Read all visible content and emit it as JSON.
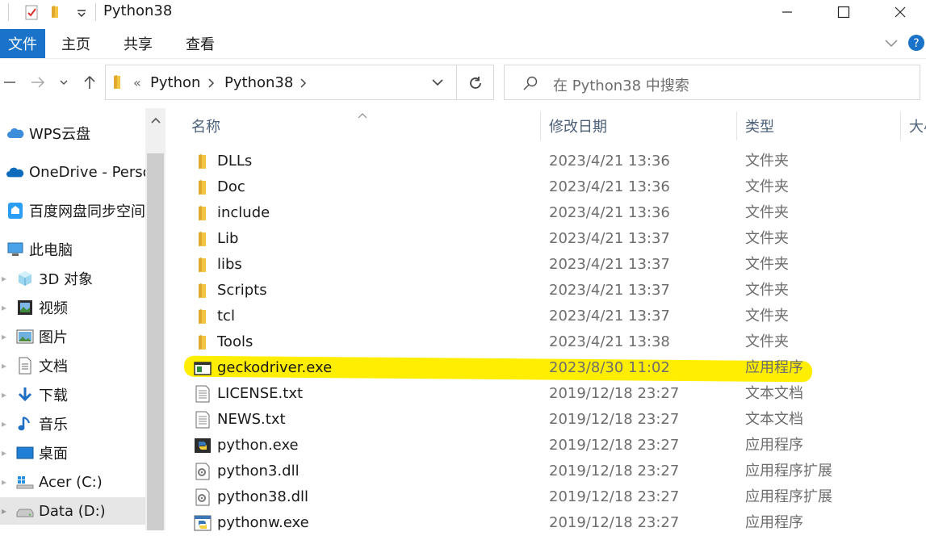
{
  "window": {
    "title": "Python38"
  },
  "ribbon": {
    "tabs": [
      "文件",
      "主页",
      "共享",
      "查看"
    ]
  },
  "address": {
    "prefix": "«",
    "crumbs": [
      "Python",
      "Python38"
    ]
  },
  "search": {
    "placeholder": "在 Python38 中搜索"
  },
  "sidebar": {
    "items": [
      {
        "label": "WPS云盘",
        "icon": "cloud-icon"
      },
      {
        "label": "OneDrive - Personal",
        "icon": "onedrive-icon"
      },
      {
        "label": "百度网盘同步空间",
        "icon": "baidu-netdisk-icon"
      },
      {
        "label": "此电脑",
        "icon": "computer-icon"
      },
      {
        "label": "3D 对象",
        "icon": "cube-icon"
      },
      {
        "label": "视频",
        "icon": "video-icon"
      },
      {
        "label": "图片",
        "icon": "picture-icon"
      },
      {
        "label": "文档",
        "icon": "document-icon"
      },
      {
        "label": "下载",
        "icon": "download-icon"
      },
      {
        "label": "音乐",
        "icon": "music-icon"
      },
      {
        "label": "桌面",
        "icon": "desktop-icon"
      },
      {
        "label": "Acer (C:)",
        "icon": "drive-icon"
      },
      {
        "label": "Data (D:)",
        "icon": "drive-icon"
      }
    ]
  },
  "columns": {
    "name": "名称",
    "date": "修改日期",
    "type": "类型",
    "size": "大小"
  },
  "files": [
    {
      "name": "DLLs",
      "date": "2023/4/21 13:36",
      "type": "文件夹",
      "icon": "folder-icon"
    },
    {
      "name": "Doc",
      "date": "2023/4/21 13:36",
      "type": "文件夹",
      "icon": "folder-icon"
    },
    {
      "name": "include",
      "date": "2023/4/21 13:36",
      "type": "文件夹",
      "icon": "folder-icon"
    },
    {
      "name": "Lib",
      "date": "2023/4/21 13:37",
      "type": "文件夹",
      "icon": "folder-icon"
    },
    {
      "name": "libs",
      "date": "2023/4/21 13:37",
      "type": "文件夹",
      "icon": "folder-icon"
    },
    {
      "name": "Scripts",
      "date": "2023/4/21 13:37",
      "type": "文件夹",
      "icon": "folder-icon"
    },
    {
      "name": "tcl",
      "date": "2023/4/21 13:37",
      "type": "文件夹",
      "icon": "folder-icon"
    },
    {
      "name": "Tools",
      "date": "2023/4/21 13:38",
      "type": "文件夹",
      "icon": "folder-icon"
    },
    {
      "name": "geckodriver.exe",
      "date": "2023/8/30 11:02",
      "type": "应用程序",
      "icon": "exe-icon"
    },
    {
      "name": "LICENSE.txt",
      "date": "2019/12/18 23:27",
      "type": "文本文档",
      "icon": "text-file-icon"
    },
    {
      "name": "NEWS.txt",
      "date": "2019/12/18 23:27",
      "type": "文本文档",
      "icon": "text-file-icon"
    },
    {
      "name": "python.exe",
      "date": "2019/12/18 23:27",
      "type": "应用程序",
      "icon": "python-icon"
    },
    {
      "name": "python3.dll",
      "date": "2019/12/18 23:27",
      "type": "应用程序扩展",
      "icon": "dll-icon"
    },
    {
      "name": "python38.dll",
      "date": "2019/12/18 23:27",
      "type": "应用程序扩展",
      "icon": "dll-icon"
    },
    {
      "name": "pythonw.exe",
      "date": "2019/12/18 23:27",
      "type": "应用程序",
      "icon": "python-icon"
    }
  ],
  "colors": {
    "accent": "#1a73c8",
    "highlight": "#ffee00",
    "folder": "#f4c542"
  }
}
